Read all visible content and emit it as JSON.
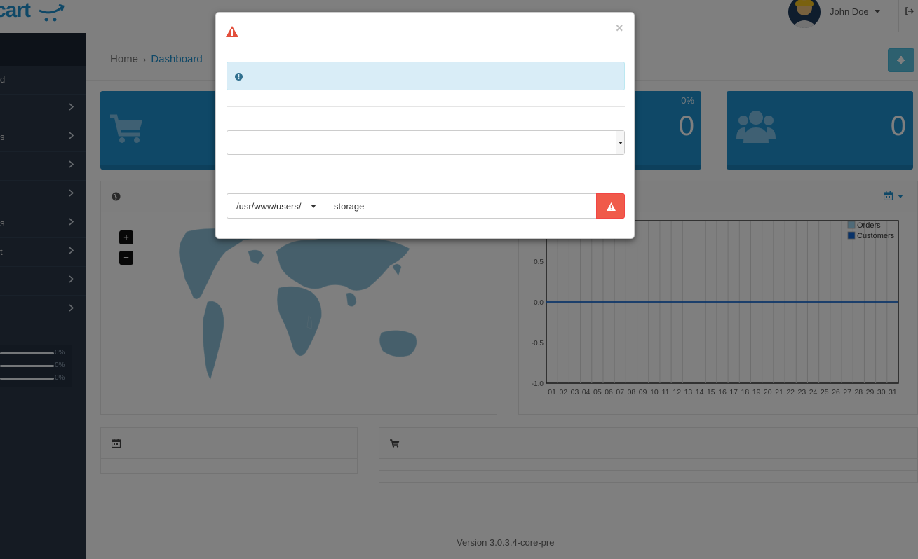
{
  "header": {
    "logo_text": "cart",
    "user_name": "John Doe"
  },
  "sidebar": {
    "items": [
      {
        "label": "d",
        "has_children": false
      },
      {
        "label": "",
        "has_children": true
      },
      {
        "label": "s",
        "has_children": true
      },
      {
        "label": "",
        "has_children": true
      },
      {
        "label": "",
        "has_children": true
      },
      {
        "label": "s",
        "has_children": true
      },
      {
        "label": "t",
        "has_children": true
      },
      {
        "label": "",
        "has_children": true
      },
      {
        "label": "",
        "has_children": true
      }
    ],
    "stats": [
      {
        "percent": "0%",
        "fill": 0
      },
      {
        "percent": "0%",
        "fill": 0
      },
      {
        "percent": "0%",
        "fill": 0
      }
    ]
  },
  "breadcrumb": {
    "home": "Home",
    "separator": "›",
    "current": "Dashboard"
  },
  "tiles": {
    "tile3_percent": "0%",
    "tile3_value": "0",
    "tile4_value": "0"
  },
  "map": {
    "zoom_in": "+",
    "zoom_out": "−"
  },
  "chart_data": {
    "type": "line",
    "x": [
      "01",
      "02",
      "03",
      "04",
      "05",
      "06",
      "07",
      "08",
      "09",
      "10",
      "11",
      "12",
      "13",
      "14",
      "15",
      "16",
      "17",
      "18",
      "19",
      "20",
      "21",
      "22",
      "23",
      "24",
      "25",
      "26",
      "27",
      "28",
      "29",
      "30",
      "31"
    ],
    "y_ticks": [
      "0.5",
      "0.0",
      "-0.5",
      "-1.0"
    ],
    "ylim": [
      -1.0,
      1.0
    ],
    "grid": true,
    "legend_position": "top-right",
    "series": [
      {
        "name": "Orders",
        "color": "#9fd5f1",
        "values": [
          0,
          0,
          0,
          0,
          0,
          0,
          0,
          0,
          0,
          0,
          0,
          0,
          0,
          0,
          0,
          0,
          0,
          0,
          0,
          0,
          0,
          0,
          0,
          0,
          0,
          0,
          0,
          0,
          0,
          0,
          0
        ]
      },
      {
        "name": "Customers",
        "color": "#1065d2",
        "values": [
          0,
          0,
          0,
          0,
          0,
          0,
          0,
          0,
          0,
          0,
          0,
          0,
          0,
          0,
          0,
          0,
          0,
          0,
          0,
          0,
          0,
          0,
          0,
          0,
          0,
          0,
          0,
          0,
          0,
          0,
          0
        ]
      }
    ]
  },
  "modal": {
    "title_icon": "warning-icon",
    "info_icon": "exclamation-circle-icon",
    "close_label": "×",
    "select_value": "",
    "path_dropdown": "/usr/www/users/",
    "path_input_value": "storage",
    "action_button_icon": "warning-icon"
  },
  "footer": {
    "version": "Version 3.0.3.4-core-pre"
  },
  "colors": {
    "accent": "#1e91cf",
    "danger": "#f05a4a",
    "info_bg": "#d9edf7",
    "sidebar_bg": "#2a3747"
  }
}
